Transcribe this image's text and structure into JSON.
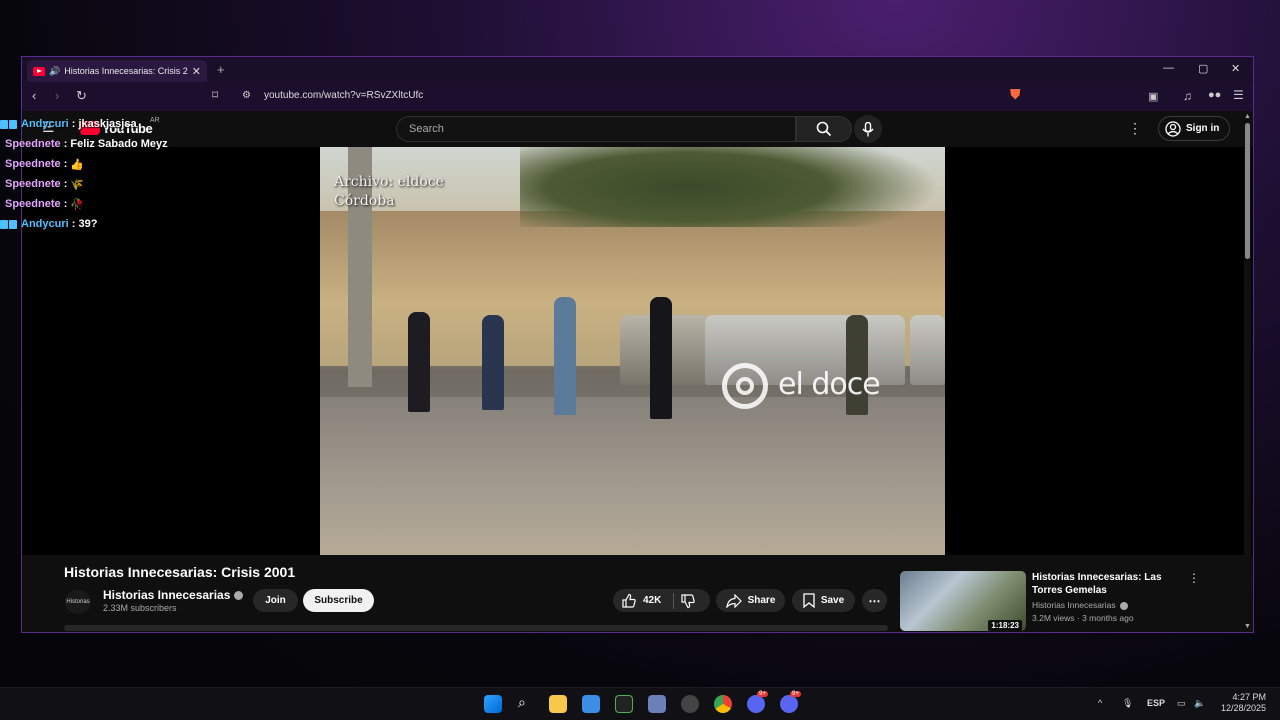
{
  "browser": {
    "tab_title": "Historias Innecesarias: Crisis 2",
    "url": "youtube.com/watch?v=RSvZXltcUfc"
  },
  "youtube": {
    "logo": "YouTube",
    "region": "AR",
    "search_placeholder": "Search",
    "sign_in": "Sign in"
  },
  "video": {
    "overlay_text_1": "Archivo: eldoce",
    "overlay_text_2": "Córdoba",
    "watermark": "el doce",
    "title": "Historias Innecesarias: Crisis 2001",
    "channel": "Historias Innecesarias",
    "channel_avatar_text": "Historias",
    "subscribers": "2.33M subscribers",
    "join": "Join",
    "subscribe": "Subscribe",
    "likes": "42K",
    "share": "Share",
    "save": "Save"
  },
  "recommendation": {
    "title": "Historias Innecesarias: Las Torres Gemelas",
    "channel": "Historias Innecesarias",
    "meta": "3.2M views · 3 months ago",
    "duration": "1:18:23"
  },
  "chat": [
    {
      "user": "Andycuri",
      "message": "jkaskjasjsa",
      "color": "#4ec0ff",
      "badge": true
    },
    {
      "user": "Speednete",
      "message": "Feliz Sabado Meyz",
      "color": "#e3a6ff",
      "badge": false
    },
    {
      "user": "Speednete",
      "message": "👍",
      "color": "#e3a6ff",
      "badge": false
    },
    {
      "user": "Speednete",
      "message": "🌾",
      "color": "#e3a6ff",
      "badge": false
    },
    {
      "user": "Speednete",
      "message": "🥀",
      "color": "#e3a6ff",
      "badge": false
    },
    {
      "user": "Andycuri",
      "message": "39?",
      "color": "#4ec0ff",
      "badge": true
    }
  ],
  "taskbar": {
    "language": "ESP",
    "time": "4:27 PM",
    "date": "12/28/2025",
    "badge_count": "9+"
  },
  "colors": {
    "accent": "#5a2a8c",
    "youtube_red": "#ff0033",
    "chat_blue": "#4ec0ff",
    "chat_pink": "#e3a6ff"
  }
}
